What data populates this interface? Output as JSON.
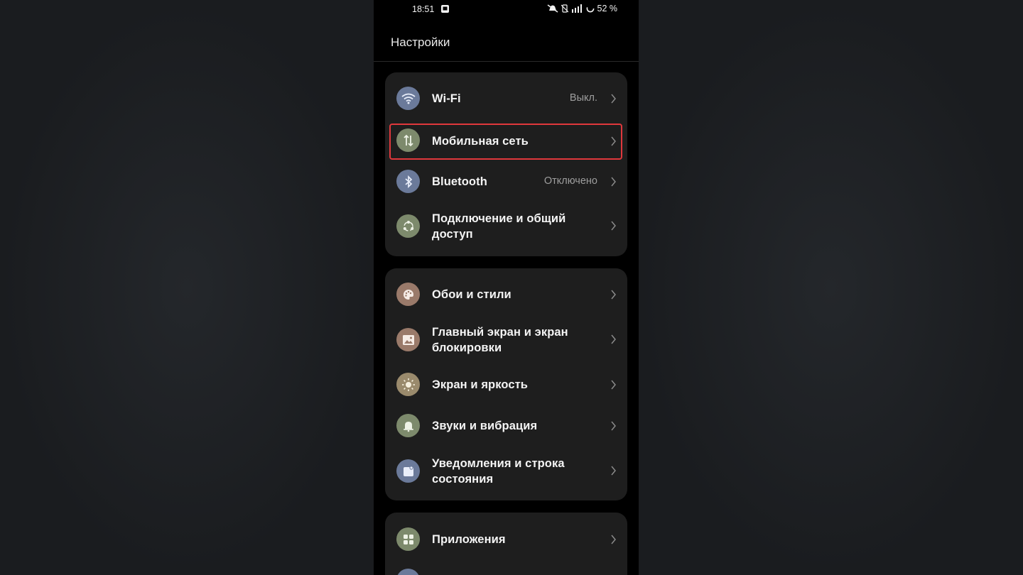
{
  "statusbar": {
    "time": "18:51",
    "battery": "52 %"
  },
  "screen": {
    "title": "Настройки"
  },
  "group1": [
    {
      "label": "Wi-Fi",
      "value": "Выкл.",
      "icon": "wifi-icon",
      "color": "#6b7a9a"
    },
    {
      "label": "Мобильная сеть",
      "value": "",
      "icon": "mobile-data-icon",
      "color": "#7d8a6c"
    },
    {
      "label": "Bluetooth",
      "value": "Отключено",
      "icon": "bluetooth-icon",
      "color": "#6b7a9a"
    },
    {
      "label": "Подключение и общий доступ",
      "label_line1": "Подключение и общий",
      "label_line2": "доступ",
      "value": "",
      "icon": "share-icon",
      "color": "#7d8a6c"
    }
  ],
  "group2": [
    {
      "label": "Обои и стили",
      "icon": "palette-icon",
      "color": "#9a7a6a"
    },
    {
      "label_line1": "Главный экран и экран",
      "label_line2": "блокировки",
      "icon": "image-icon",
      "color": "#9a7a6a"
    },
    {
      "label": "Экран и яркость",
      "icon": "brightness-icon",
      "color": "#9a8a6c"
    },
    {
      "label": "Звуки и вибрация",
      "icon": "bell-icon",
      "color": "#7d8a6c"
    },
    {
      "label_line1": "Уведомления и строка",
      "label_line2": "состояния",
      "icon": "notification-icon",
      "color": "#6b7a9a"
    }
  ],
  "group3": [
    {
      "label": "Приложения",
      "icon": "apps-icon",
      "color": "#7d8a6c"
    }
  ],
  "highlight_color": "#e0383c"
}
